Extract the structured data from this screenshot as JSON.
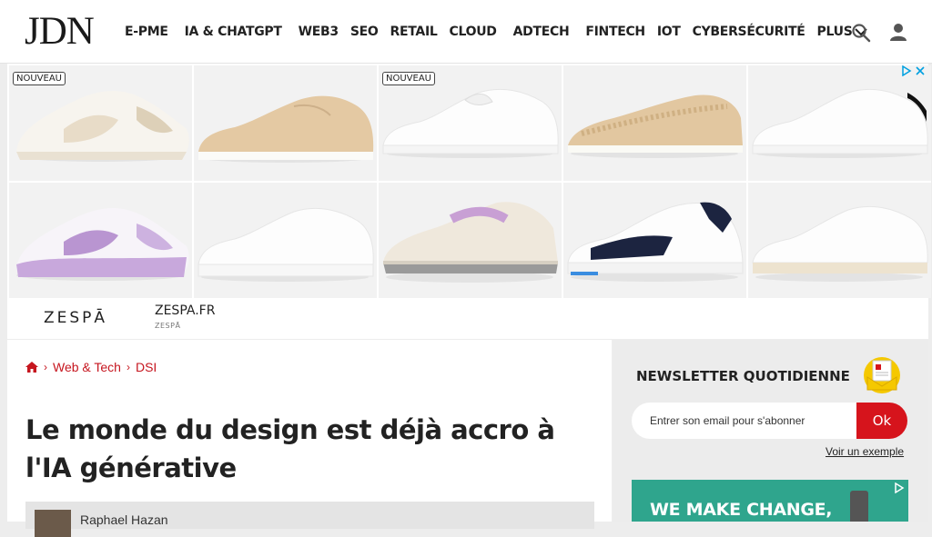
{
  "header": {
    "logo": "JDN",
    "nav": [
      "E-PME",
      "IA & CHATGPT",
      "WEB3",
      "SEO",
      "RETAIL",
      "CLOUD",
      "ADTECH",
      "FINTECH",
      "IOT",
      "CYBERSÉCURITÉ"
    ],
    "more_label": "PLUS"
  },
  "ad": {
    "badge_new": "NOUVEAU",
    "brand_logo": "ZESPĀ",
    "brand_url": "ZESPA.FR",
    "brand_name": "ZESPĀ",
    "tiles": [
      {
        "product": "chunky sneaker beige",
        "badge": true
      },
      {
        "product": "suede sneaker sand",
        "badge": false
      },
      {
        "product": "white leather sneaker",
        "badge": true
      },
      {
        "product": "woven slip-on sand",
        "badge": false
      },
      {
        "product": "white sneaker black heel",
        "badge": false
      },
      {
        "product": "chunky sneaker lilac",
        "badge": false
      },
      {
        "product": "white platform sneaker",
        "badge": false
      },
      {
        "product": "running sneaker beige lilac",
        "badge": false
      },
      {
        "product": "navy white sneaker",
        "badge": false
      },
      {
        "product": "white retro sneaker",
        "badge": false
      }
    ],
    "colors": {
      "accent": "#00a0e0"
    }
  },
  "breadcrumb": {
    "items": [
      "Web & Tech",
      "DSI"
    ]
  },
  "article": {
    "title": "Le monde du design est déjà accro à l'IA générative",
    "author": "Raphael Hazan"
  },
  "newsletter": {
    "title": "NEWSLETTER QUOTIDIENNE",
    "placeholder": "Entrer son email pour s'abonner",
    "submit": "Ok",
    "example": "Voir un exemple"
  },
  "sidebar_ad": {
    "text": "WE MAKE CHANGE,"
  },
  "colors": {
    "brand_red": "#d6141c",
    "link_red": "#c6161f"
  }
}
